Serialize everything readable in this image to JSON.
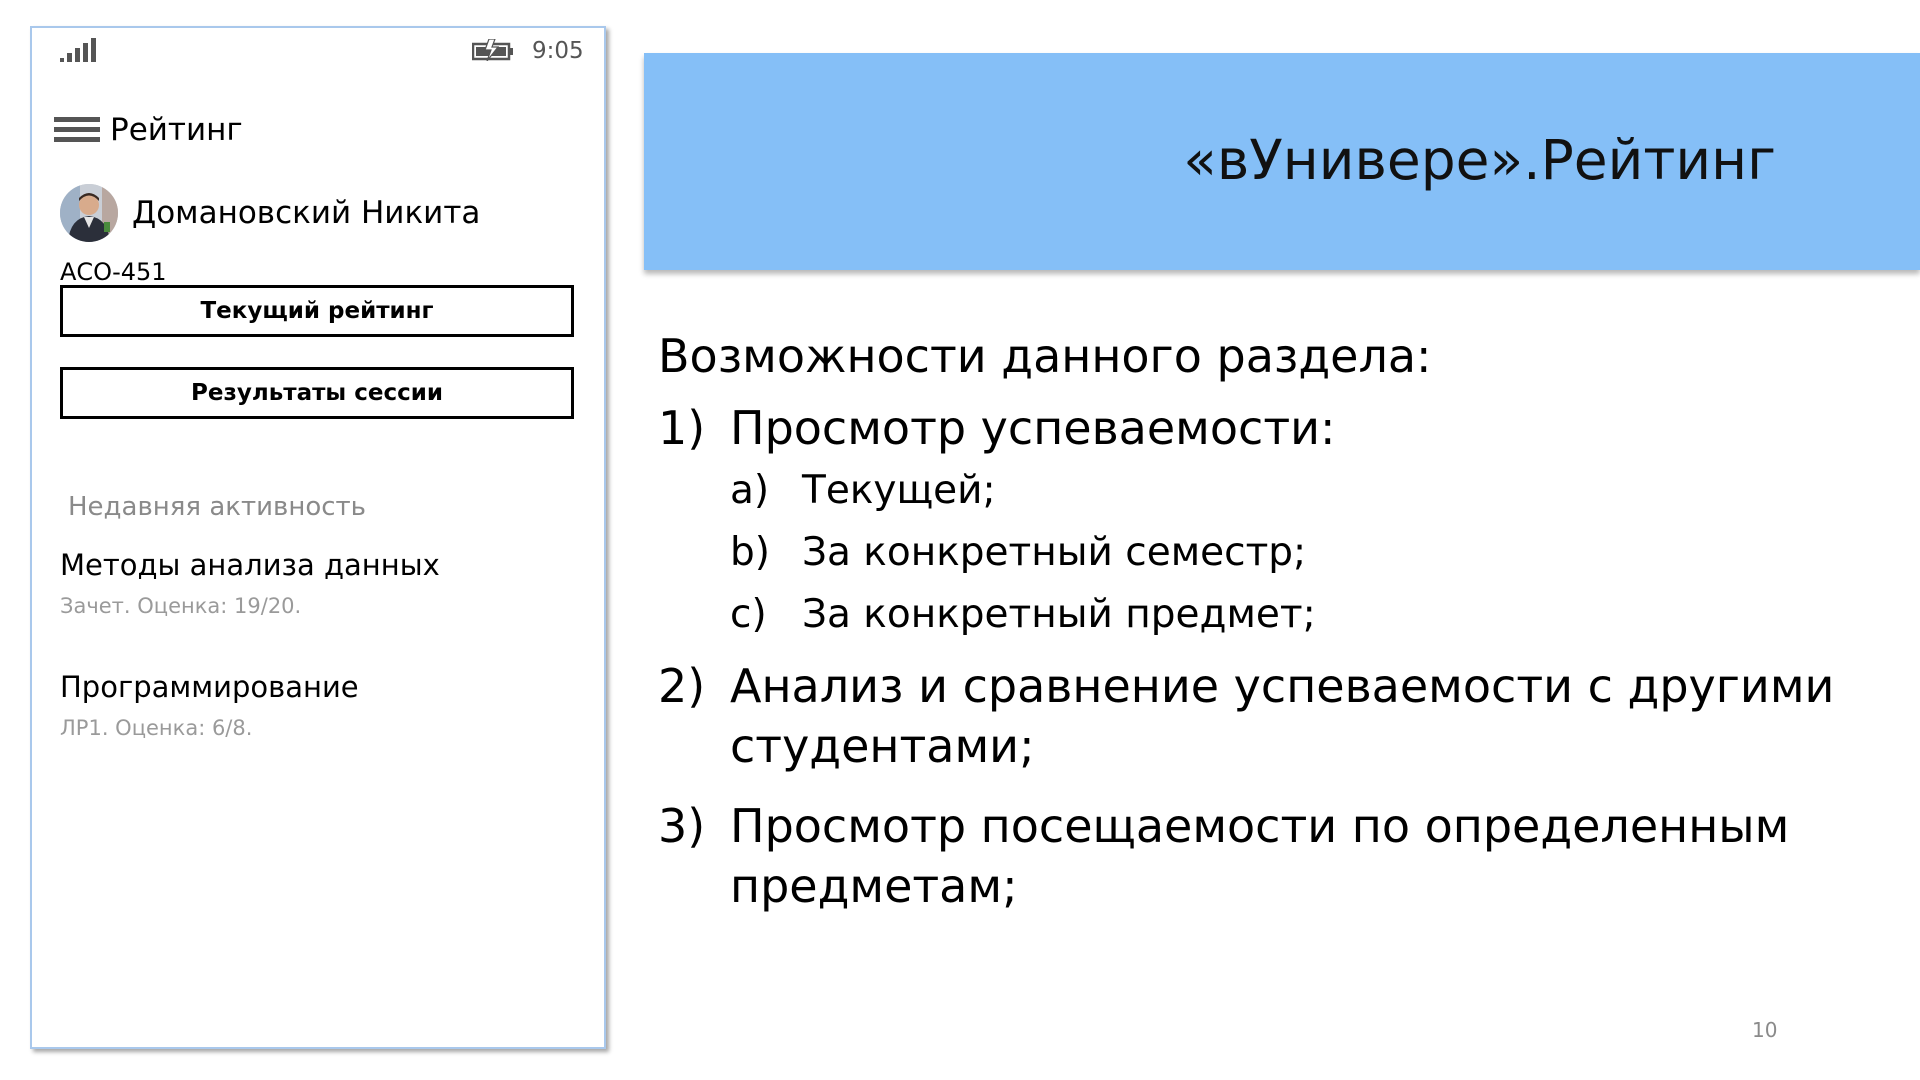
{
  "phone": {
    "status_bar": {
      "time": "9:05",
      "signal_icon": "signal-icon",
      "battery_icon": "battery-icon"
    },
    "header": {
      "menu_icon": "hamburger-menu-icon",
      "title": "Рейтинг"
    },
    "profile": {
      "name": "Домановский Никита",
      "group": "АСО-451"
    },
    "buttons": {
      "current_rating": "Текущий рейтинг",
      "session_results": "Результаты сессии"
    },
    "recent": {
      "title": "Недавняя активность",
      "items": [
        {
          "title": "Методы анализа данных",
          "detail": "Зачет. Оценка: 19/20."
        },
        {
          "title": "Программирование",
          "detail": "ЛР1. Оценка: 6/8."
        }
      ]
    }
  },
  "slide": {
    "title": "«вУнивере».Рейтинг",
    "lead": "Возможности данного раздела:",
    "items": [
      {
        "num": "1)",
        "text": "Просмотр успеваемости:",
        "subitems": [
          {
            "num": "a)",
            "text": "Текущей;"
          },
          {
            "num": "b)",
            "text": "За конкретный семестр;"
          },
          {
            "num": "c)",
            "text": "За конкретный предмет;"
          }
        ]
      },
      {
        "num": "2)",
        "text": "Анализ и сравнение успеваемости с другими студентами;"
      },
      {
        "num": "3)",
        "text": "Просмотр посещаемости по определенным предметам;"
      }
    ],
    "page_number": "10"
  },
  "colors": {
    "banner": "#85bff7",
    "phone_border": "#a9c8ec",
    "muted_text": "#8a8a8a"
  }
}
